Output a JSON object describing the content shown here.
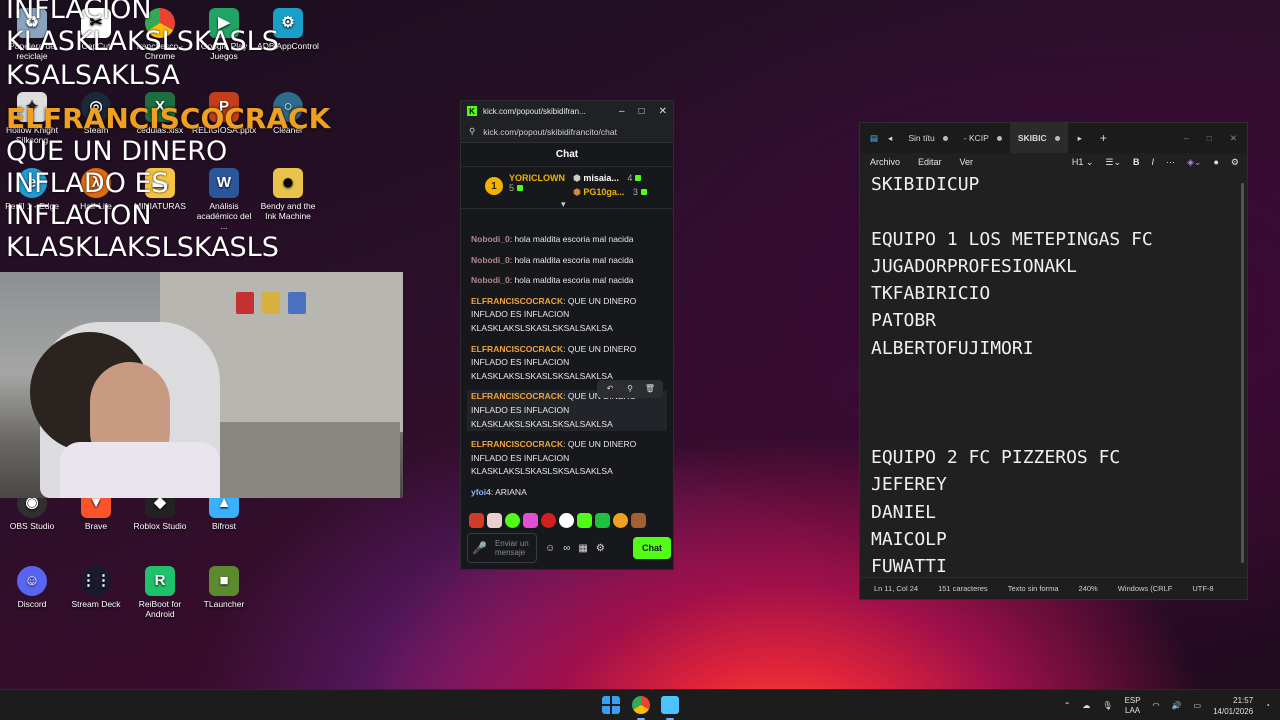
{
  "desktop": {
    "icons": [
      {
        "label": "Papelera de reciclaje",
        "name": "recycle-bin-icon"
      },
      {
        "label": "CapCut",
        "name": "capcut-icon"
      },
      {
        "label": "franchesco - Chrome",
        "name": "chrome-icon"
      },
      {
        "label": "Google Play Juegos",
        "name": "google-play-icon"
      },
      {
        "label": "ADB AppControl",
        "name": "adb-appcontrol-icon"
      },
      {
        "label": "Hollow Knight Silksong",
        "name": "hollow-knight-icon"
      },
      {
        "label": "Steam",
        "name": "steam-icon"
      },
      {
        "label": "cedulas.xlsx",
        "name": "excel-file-icon"
      },
      {
        "label": "RELIGIOSA.pptx",
        "name": "powerpoint-file-icon"
      },
      {
        "label": "Cleaner",
        "name": "cleaner-icon"
      },
      {
        "label": "Perfil 1 - Edge",
        "name": "edge-icon"
      },
      {
        "label": "Half-Life",
        "name": "half-life-icon"
      },
      {
        "label": "MINIATURAS",
        "name": "folder-icon"
      },
      {
        "label": "Análisis académico del ...",
        "name": "word-file-icon"
      },
      {
        "label": "Bendy and the Ink Machine",
        "name": "bendy-icon"
      },
      {
        "label": "OBS Studio",
        "name": "obs-icon"
      },
      {
        "label": "Brave",
        "name": "brave-icon"
      },
      {
        "label": "Roblox Studio",
        "name": "roblox-studio-icon"
      },
      {
        "label": "Bifrost",
        "name": "bifrost-icon"
      },
      {
        "label": "Discord",
        "name": "discord-icon"
      },
      {
        "label": "Stream Deck",
        "name": "stream-deck-icon"
      },
      {
        "label": "ReiBoot for Android",
        "name": "reiboot-icon"
      },
      {
        "label": "TLauncher",
        "name": "tlauncher-icon"
      }
    ]
  },
  "overlay": {
    "line1": "INFLACION",
    "line2": "KLASKLAKSLSKASLS",
    "line3": "KSALSAKLSA",
    "name": "ELFRANCISCOCRACK",
    "line4": "QUE UN DINERO",
    "line5": "INFLADO ES",
    "line6": "INFLACION",
    "line7": "KLASKLAKSLSKASLS"
  },
  "kick": {
    "tab_title": "kick.com/popout/skibidifran...",
    "url": "kick.com/popout/skibidifrancito/chat",
    "header": "Chat",
    "leaders": {
      "first_name": "YORICLOWN",
      "first_count": "5",
      "second_name": "misaia...",
      "second_count": "4",
      "third_name": "PG10ga...",
      "third_count": "3"
    },
    "messages": [
      {
        "user": "Nobodi_0",
        "text": ": hola maldita escoria mal nacida",
        "color": "gray"
      },
      {
        "user": "Nobodi_0",
        "text": ": hola maldita escoria mal nacida",
        "color": "gray"
      },
      {
        "user": "Nobodi_0",
        "text": ": hola maldita escoria mal nacida",
        "color": "gray"
      },
      {
        "user": "ELFRANCISCOCRACK",
        "text": ": QUE UN DINERO INFLADO ES INFLACION KLASKLAKSLSKASLSKSALSAKLSA",
        "color": "orange"
      },
      {
        "user": "ELFRANCISCOCRACK",
        "text": ": QUE UN DINERO INFLADO ES INFLACION KLASKLAKSLSKASLSKSALSAKLSA",
        "color": "orange"
      },
      {
        "user": "ELFRANCISCOCRACK",
        "text": ": QUE UN DINERO INFLADO ES INFLACION KLASKLAKSLSKASLSKSALSAKLSA",
        "color": "orange"
      },
      {
        "user": "ELFRANCISCOCRACK",
        "text": ": QUE UN DINERO INFLADO ES INFLACION KLASKLAKSLSKASLSKSALSAKLSA",
        "color": "orange"
      },
      {
        "user": "yfoi4",
        "text": ": ARIANA",
        "color": "blue"
      }
    ],
    "input_placeholder": "Enviar un mensaje",
    "chat_button": "Chat",
    "accent": "#53fc18"
  },
  "notepad": {
    "tabs": [
      "Sin títu",
      "- KCIP",
      "SKIBIC"
    ],
    "menu": [
      "Archivo",
      "Editar",
      "Ver"
    ],
    "heading_select": "H1",
    "content": "SKIBIDICUP\n\nEQUIPO 1 LOS METEPINGAS FC\nJUGADORPROFESIONAKL\nTKFABIRICIO\nPATOBR\nALBERTOFUJIMORI\n\n\n\nEQUIPO 2 FC PIZZEROS FC\nJEFEREY\nDANIEL\nMAICOLP\nFUWATTI",
    "status": {
      "position": "Ln 11, Col 24",
      "chars": "151 caracteres",
      "format": "Texto sin forma",
      "zoom": "240%",
      "eol": "Windows (CRLF",
      "encoding": "UTF-8"
    }
  },
  "taskbar": {
    "lang": "ESP",
    "layout": "LAA",
    "time": "21:57",
    "date": "14/01/2026"
  }
}
